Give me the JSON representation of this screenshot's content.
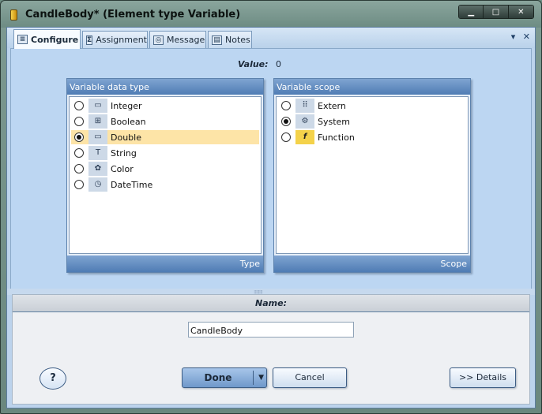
{
  "window": {
    "title": "CandleBody* (Element type Variable)",
    "controls": {
      "minimize": "▁",
      "maximize": "□",
      "close": "✕"
    }
  },
  "tabs": [
    {
      "label": "Configure",
      "icon": "list-icon"
    },
    {
      "label": "Assignment",
      "icon": "sigma-icon"
    },
    {
      "label": "Message",
      "icon": "globe-icon"
    },
    {
      "label": "Notes",
      "icon": "notes-icon"
    }
  ],
  "tabbar_controls": {
    "dropdown": "▾",
    "close": "✕"
  },
  "value": {
    "label": "Value:",
    "text": "0"
  },
  "data_type": {
    "header": "Variable data type",
    "footer": "Type",
    "options": [
      {
        "label": "Integer",
        "icon": "integer-icon",
        "glyph": "▭",
        "selected": false
      },
      {
        "label": "Boolean",
        "icon": "boolean-icon",
        "glyph": "⊞",
        "selected": false
      },
      {
        "label": "Double",
        "icon": "double-icon",
        "glyph": "▭",
        "selected": true
      },
      {
        "label": "String",
        "icon": "string-icon",
        "glyph": "T",
        "selected": false
      },
      {
        "label": "Color",
        "icon": "color-icon",
        "glyph": "✿",
        "selected": false
      },
      {
        "label": "DateTime",
        "icon": "clock-icon",
        "glyph": "◷",
        "selected": false
      }
    ]
  },
  "scope": {
    "header": "Variable scope",
    "footer": "Scope",
    "options": [
      {
        "label": "Extern",
        "icon": "extern-icon",
        "glyph": "⠿",
        "selected": false
      },
      {
        "label": "System",
        "icon": "system-icon",
        "glyph": "⚙",
        "selected": true
      },
      {
        "label": "Function",
        "icon": "function-icon",
        "glyph": "f",
        "selected": false
      }
    ]
  },
  "name_panel": {
    "label": "Name:",
    "value": "CandleBody"
  },
  "buttons": {
    "help": "?",
    "done": "Done",
    "done_arrow": "▼",
    "cancel": "Cancel",
    "details": ">> Details"
  },
  "colors": {
    "selection": "#fde4a7",
    "group_header": "#4f7cb4",
    "client": "#bcd3ec"
  }
}
